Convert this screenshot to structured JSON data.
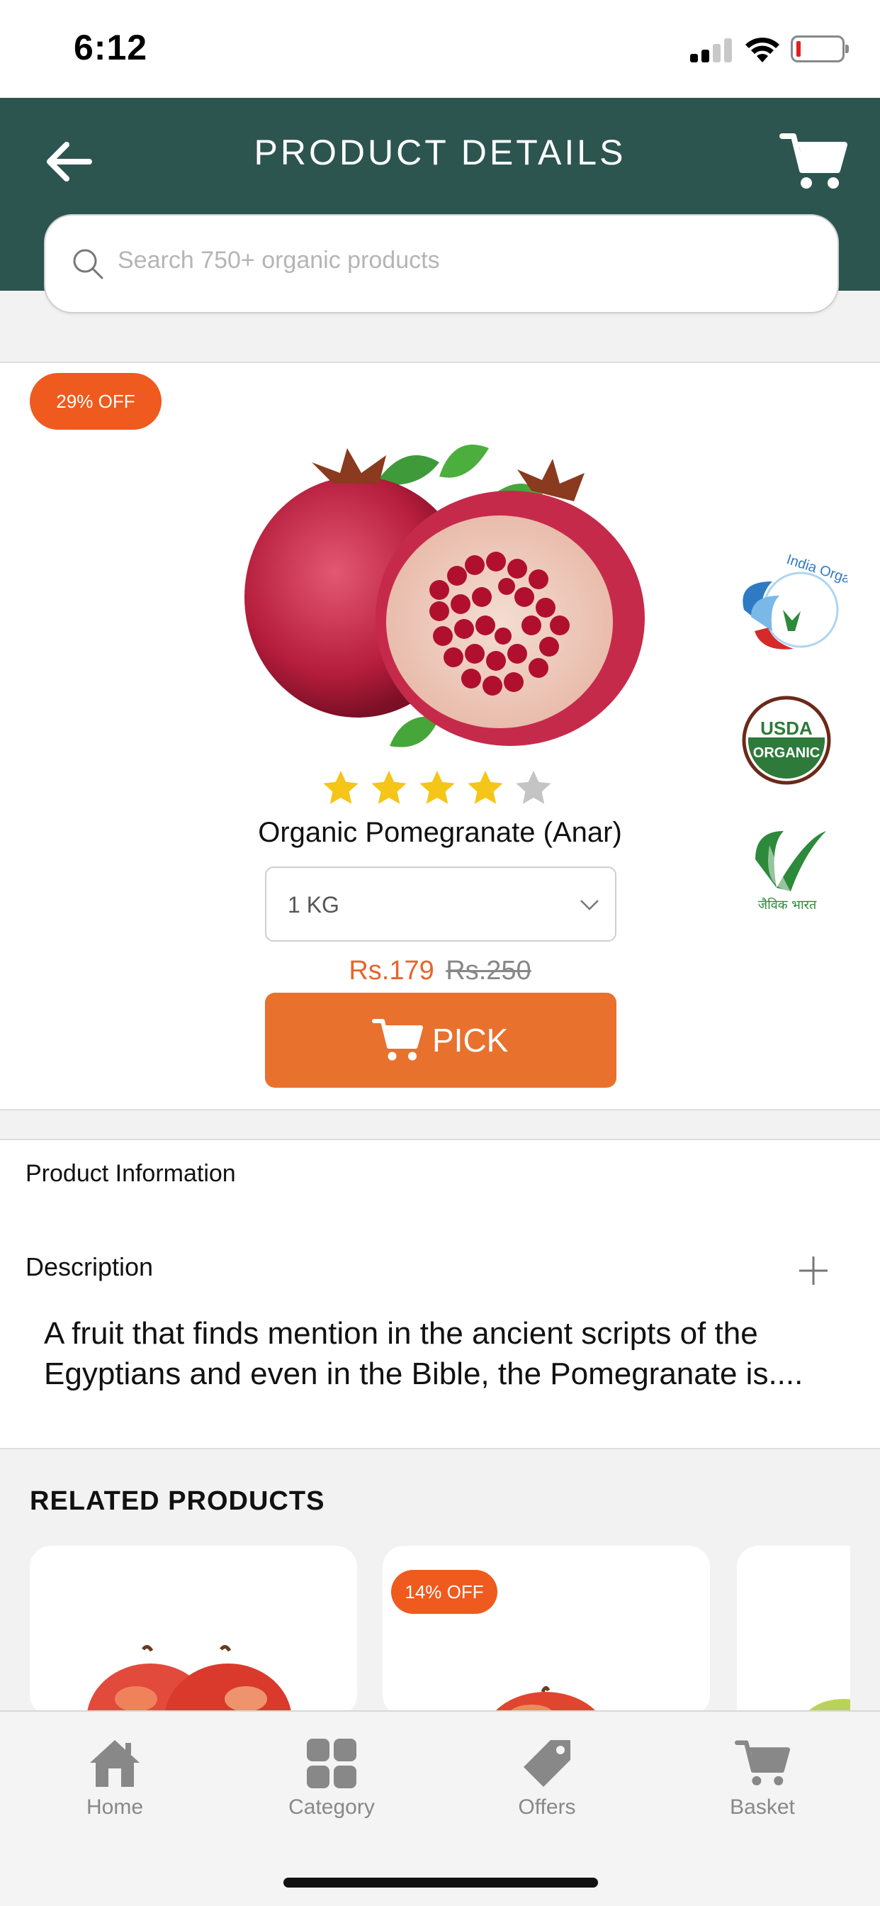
{
  "status_bar": {
    "time": "6:12"
  },
  "header": {
    "title": "PRODUCT DETAILS"
  },
  "search": {
    "placeholder": "Search 750+ organic products"
  },
  "product": {
    "discount": "29% OFF",
    "rating": 4,
    "rating_max": 5,
    "name": "Organic Pomegranate (Anar)",
    "weight_selected": "1 KG",
    "price_current": "Rs.179",
    "price_old": "Rs.250",
    "pick_label": "PICK",
    "certifications": {
      "india_organic_text": "India Organic",
      "usda_line1": "USDA",
      "usda_line2": "ORGANIC",
      "jaivik_text": "जैविक भारत"
    }
  },
  "product_information": {
    "title": "Product Information"
  },
  "description": {
    "title": "Description",
    "text": "A fruit that finds mention in the ancient scripts of the Egyptians and even in the Bible, the Pomegranate is...."
  },
  "related": {
    "title": "RELATED PRODUCTS",
    "items": [
      {
        "badge": ""
      },
      {
        "badge": "14% OFF"
      },
      {
        "badge": ""
      }
    ]
  },
  "bottom_nav": {
    "items": [
      {
        "label": "Home",
        "icon": "home-icon"
      },
      {
        "label": "Category",
        "icon": "category-icon"
      },
      {
        "label": "Offers",
        "icon": "offers-tag-icon"
      },
      {
        "label": "Basket",
        "icon": "basket-cart-icon"
      }
    ]
  },
  "colors": {
    "header_bg": "#2d5550",
    "accent_orange": "#e8712e",
    "badge_orange": "#ef5a1e",
    "price_orange": "#e8642c",
    "star_gold": "#f5c518",
    "star_gray": "#c4c4c4"
  }
}
